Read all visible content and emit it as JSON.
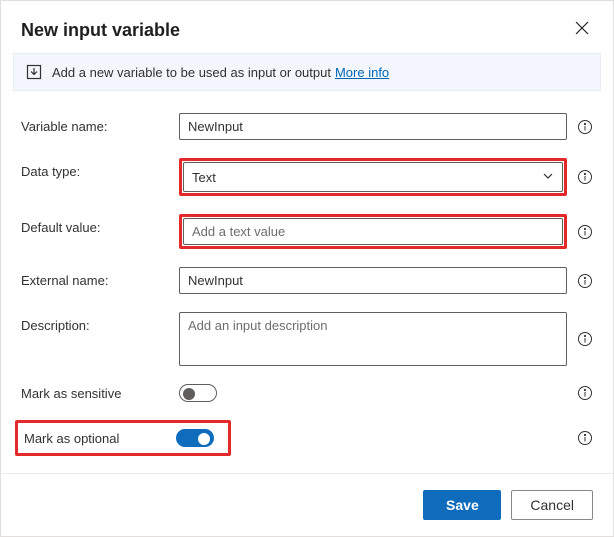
{
  "header": {
    "title": "New input variable"
  },
  "banner": {
    "text": "Add a new variable to be used as input or output",
    "link": "More info"
  },
  "fields": {
    "variable_name": {
      "label": "Variable name:",
      "value": "NewInput"
    },
    "data_type": {
      "label": "Data type:",
      "value": "Text"
    },
    "default_value": {
      "label": "Default value:",
      "placeholder": "Add a text value"
    },
    "external_name": {
      "label": "External name:",
      "value": "NewInput"
    },
    "description": {
      "label": "Description:",
      "placeholder": "Add an input description"
    },
    "sensitive": {
      "label": "Mark as sensitive",
      "value": false
    },
    "optional": {
      "label": "Mark as optional",
      "value": true
    }
  },
  "buttons": {
    "save": "Save",
    "cancel": "Cancel"
  }
}
